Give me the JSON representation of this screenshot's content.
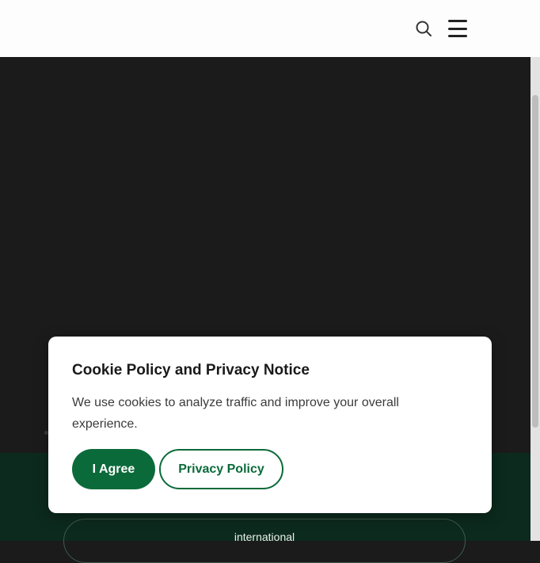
{
  "header": {
    "search_icon": "search-icon",
    "menu_icon": "hamburger-menu-icon"
  },
  "footer": {
    "international_label": "international"
  },
  "cookie_modal": {
    "title": "Cookie Policy and Privacy Notice",
    "message": "We use cookies to analyze traffic and improve your overall experience.",
    "agree_label": "I Agree",
    "privacy_label": "Privacy Policy"
  },
  "colors": {
    "accent_green": "#0b6a3a",
    "hero_background": "#1b1b1b",
    "band_background": "#0c2a1d",
    "header_background": "#fdfdfd"
  }
}
